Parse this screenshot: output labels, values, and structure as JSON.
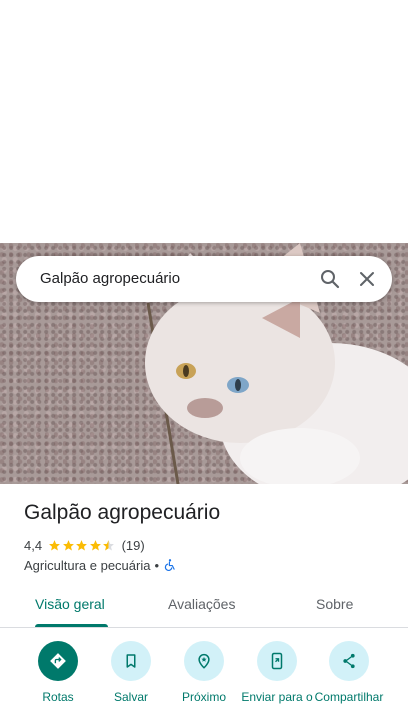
{
  "search": {
    "query": "Galpão agropecuário"
  },
  "place": {
    "title": "Galpão agropecuário",
    "rating": "4,4",
    "stars": 4.4,
    "review_count": "(19)",
    "category": "Agricultura e pecuária",
    "separator": "•"
  },
  "tabs": [
    {
      "label": "Visão geral",
      "active": true
    },
    {
      "label": "Avaliações",
      "active": false
    },
    {
      "label": "Sobre",
      "active": false
    }
  ],
  "actions": [
    {
      "label": "Rotas",
      "icon": "directions-icon"
    },
    {
      "label": "Salvar",
      "icon": "bookmark-icon"
    },
    {
      "label": "Próximo",
      "icon": "nearby-icon"
    },
    {
      "label": "Enviar para o",
      "icon": "send-to-phone-icon"
    },
    {
      "label": "Compartilhar",
      "icon": "share-icon"
    }
  ],
  "colors": {
    "accent": "#00796b",
    "action_bg": "#d2f1f8",
    "star": "#fbbc04",
    "accessibility": "#1a73e8"
  }
}
